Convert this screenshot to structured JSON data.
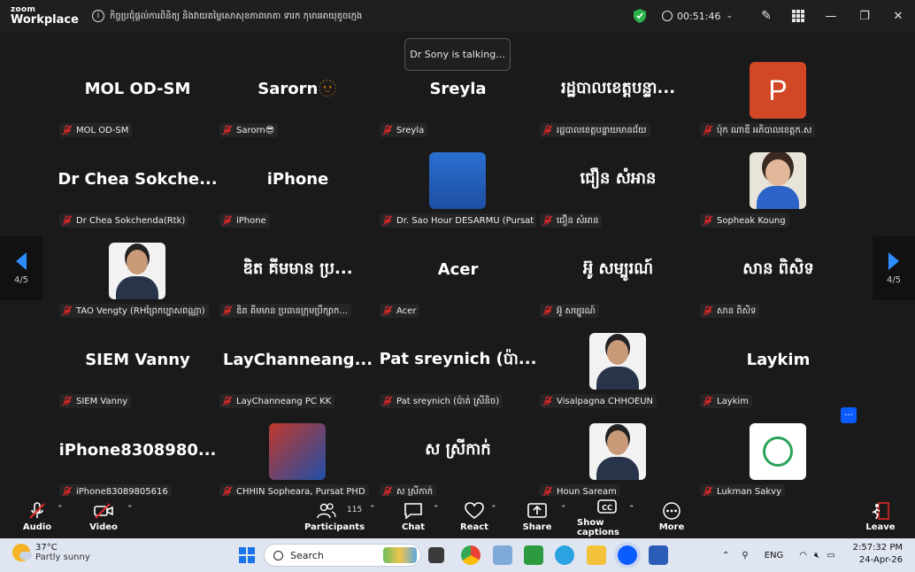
{
  "window": {
    "brand_top": "zoom",
    "brand_bottom": "Workplace",
    "meeting_title": "កិច្ចប្រជុំផ្ដល់ការពិនិត្យ និងវាយតម្លៃសោសុខភាពមាតា ទារក កុមារអាយុតូចក្មេង",
    "timer": "00:51:46"
  },
  "talking_indicator": "Dr Sony is talking...",
  "pager": {
    "left": "4/5",
    "right": "4/5"
  },
  "participants": [
    {
      "name_display": "MOL OD-SM",
      "label": "MOL OD-SM",
      "avatar": null
    },
    {
      "name_display": "Sarorn🫥",
      "label": "Sarorn😎",
      "avatar": null
    },
    {
      "name_display": "Sreyla",
      "label": "Sreyla",
      "avatar": null
    },
    {
      "name_display": "រដ្ឋបាលខេត្តបន្ទា...",
      "label": "រដ្ឋបាលខេត្តបន្ទាយមានជ័យ",
      "avatar": null
    },
    {
      "name_display": "",
      "label": "ប៉ុក ណាឌី អភិបាលខេត្តក.ស",
      "avatar": "P"
    },
    {
      "name_display": "Dr Chea Sokche...",
      "label": "Dr Chea Sokchenda(Rtk)",
      "avatar": null
    },
    {
      "name_display": "iPhone",
      "label": "iPhone",
      "avatar": null
    },
    {
      "name_display": "",
      "label": "Dr. Sao Hour DESARMU (Pursat P...",
      "avatar": "doc"
    },
    {
      "name_display": "ជឿន សំអាន",
      "label": "ជឿន សំអាន",
      "avatar": null
    },
    {
      "name_display": "",
      "label": "Sopheak Koung",
      "avatar": "photo-woman"
    },
    {
      "name_display": "",
      "label": "TAO Vengty (RHព្រៃកប្បាសពណ្ណា)",
      "avatar": "photo-man"
    },
    {
      "name_display": "ឌិត គីមមាន ប្រ...",
      "label": "ឌិត គីមមាន ប្រធានក្រុមប្រឹក្សាក...",
      "avatar": null
    },
    {
      "name_display": "Acer",
      "label": "Acer",
      "avatar": null
    },
    {
      "name_display": "អ៊ូ សម្បូរណ៍",
      "label": "អ៊ូ សម្បូរណ៍",
      "avatar": null
    },
    {
      "name_display": "សាន ពិសិទ",
      "label": "សាន ពិសិទ",
      "avatar": null
    },
    {
      "name_display": "SIEM Vanny",
      "label": "SIEM Vanny",
      "avatar": null
    },
    {
      "name_display": "LayChanneang...",
      "label": "LayChanneang PC KK",
      "avatar": null
    },
    {
      "name_display": "Pat sreynich (ប៉ា...",
      "label": "Pat sreynich (ប៉ាត់ ស្រីនិច)",
      "avatar": null
    },
    {
      "name_display": "",
      "label": "Visalpagna CHHOEUN",
      "avatar": "photo-man"
    },
    {
      "name_display": "Laykim",
      "label": "Laykim",
      "avatar": null
    },
    {
      "name_display": "iPhone8308980...",
      "label": "iPhone83089805616",
      "avatar": null
    },
    {
      "name_display": "",
      "label": "CHHIN Sopheara, Pursat PHD",
      "avatar": "photo-group"
    },
    {
      "name_display": "ស ស្រីកាក់",
      "label": "ស ស្រីកាក់",
      "avatar": null
    },
    {
      "name_display": "",
      "label": "Houn Saream",
      "avatar": "photo-man"
    },
    {
      "name_display": "",
      "label": "Lukman Sakvy",
      "avatar": "logo"
    }
  ],
  "toolbar": {
    "audio": "Audio",
    "video": "Video",
    "participants": "Participants",
    "participants_count": "115",
    "chat": "Chat",
    "react": "React",
    "share": "Share",
    "captions": "Show captions",
    "more": "More",
    "leave": "Leave"
  },
  "taskbar": {
    "temp": "37°C",
    "weather": "Partly sunny",
    "search_placeholder": "Search",
    "lang": "ENG",
    "time": "2:57:32 PM",
    "date": "24-Apr-26"
  },
  "colors": {
    "accent": "#0b5cff",
    "mute_red": "#e02828",
    "ppt_orange": "#d24726"
  }
}
